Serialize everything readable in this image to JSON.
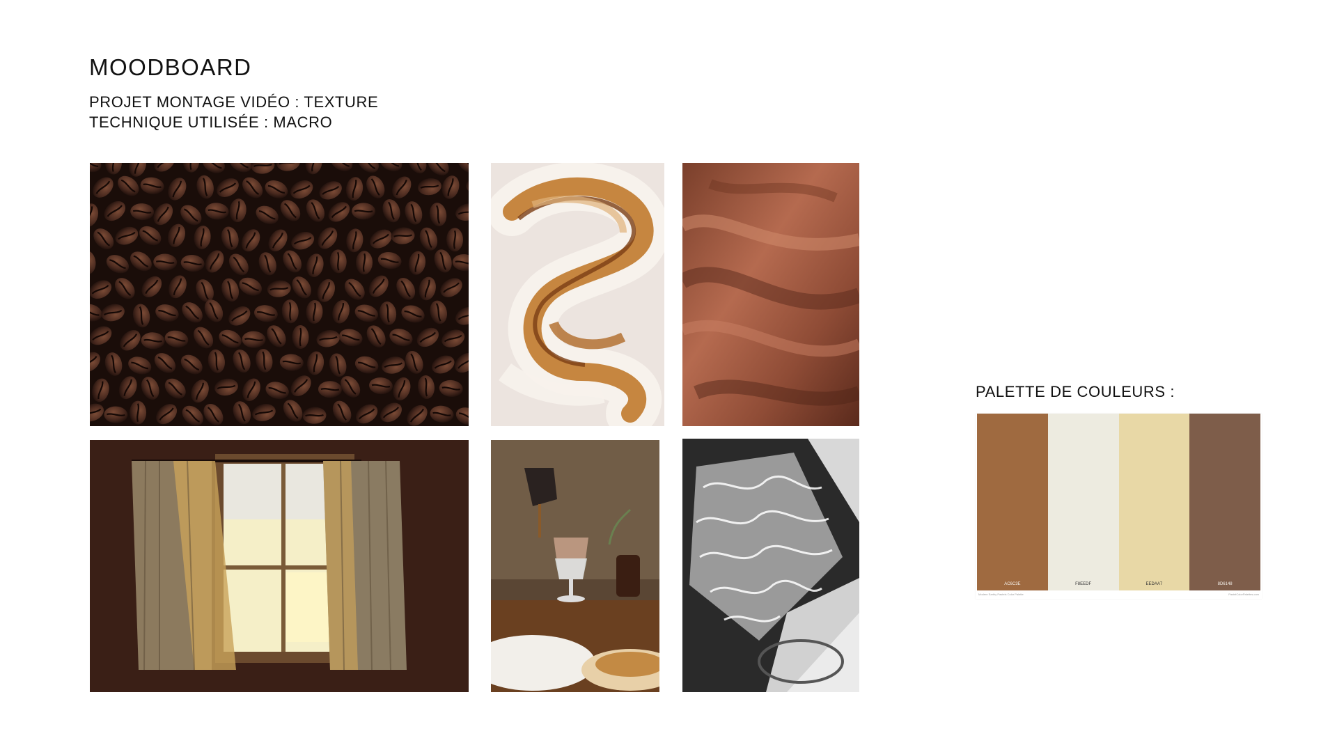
{
  "header": {
    "title": "MOODBOARD",
    "project_line": "PROJET MONTAGE VIDÉO : TEXTURE",
    "technique_line": "TECHNIQUE UTILISÉE : MACRO"
  },
  "photos": [
    {
      "subject": "coffee beans"
    },
    {
      "subject": "latte foam swirl"
    },
    {
      "subject": "brown satin fabric"
    },
    {
      "subject": "curtained window"
    },
    {
      "subject": "pouring iced coffee"
    },
    {
      "subject": "water caustics black and white"
    }
  ],
  "palette": {
    "title": "PALETTE DE COULEURS :",
    "swatches": [
      {
        "hex_label": "AC6C3E",
        "color": "#9f6a40"
      },
      {
        "hex_label": "F8EEDF",
        "color": "#edebe0"
      },
      {
        "hex_label": "EEDAA7",
        "color": "#e8d8a6"
      },
      {
        "hex_label": "8D6148",
        "color": "#7e5d4a"
      }
    ],
    "footer_left": "Modern Earthy Pastels Color Palette",
    "footer_right": "PastelColorPalettes.com"
  }
}
